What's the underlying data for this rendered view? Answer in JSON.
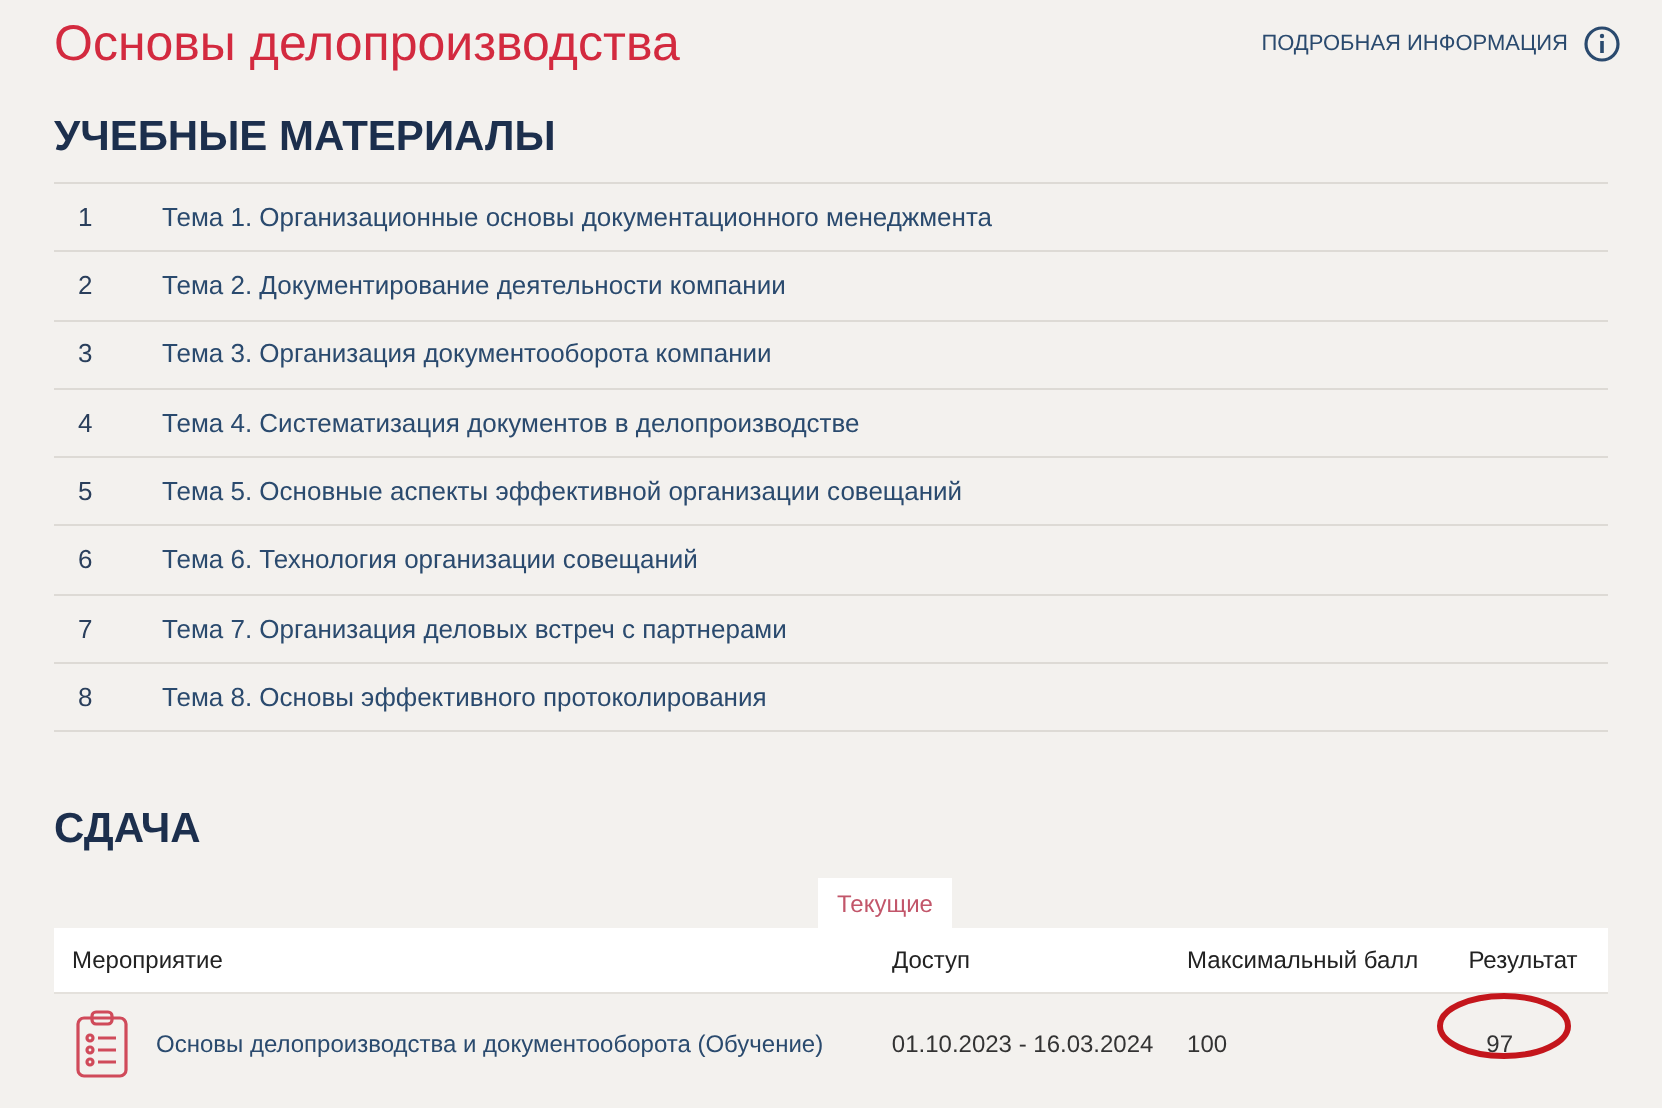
{
  "title": "Основы делопроизводства",
  "info_link": "ПОДРОБНАЯ ИНФОРМАЦИЯ",
  "materials": {
    "heading": "УЧЕБНЫЕ МАТЕРИАЛЫ",
    "rows": [
      {
        "number": "1",
        "topic": "Тема 1. Организационные основы документационного менеджмента"
      },
      {
        "number": "2",
        "topic": "Тема 2. Документирование деятельности компании"
      },
      {
        "number": "3",
        "topic": "Тема 3. Организация документооборота компании"
      },
      {
        "number": "4",
        "topic": "Тема 4. Систематизация документов в делопроизводстве"
      },
      {
        "number": "5",
        "topic": "Тема 5. Основные аспекты эффективной организации совещаний"
      },
      {
        "number": "6",
        "topic": "Тема 6. Технология организации совещаний"
      },
      {
        "number": "7",
        "topic": "Тема 7. Организация деловых встреч с партнерами"
      },
      {
        "number": "8",
        "topic": "Тема 8. Основы эффективного протоколирования"
      }
    ]
  },
  "submission": {
    "heading": "СДАЧА",
    "tabs": [
      {
        "label": "Текущие",
        "selected": true
      }
    ],
    "table": {
      "columns": [
        "Мероприятие",
        "Доступ",
        "Максимальный балл",
        "Результат"
      ],
      "rows": [
        {
          "event": "Основы делопроизводства и документооборота (Обучение)",
          "access": "01.10.2023 - 16.03.2024",
          "max_score": "100",
          "result": "97",
          "circled": true
        }
      ]
    }
  }
}
